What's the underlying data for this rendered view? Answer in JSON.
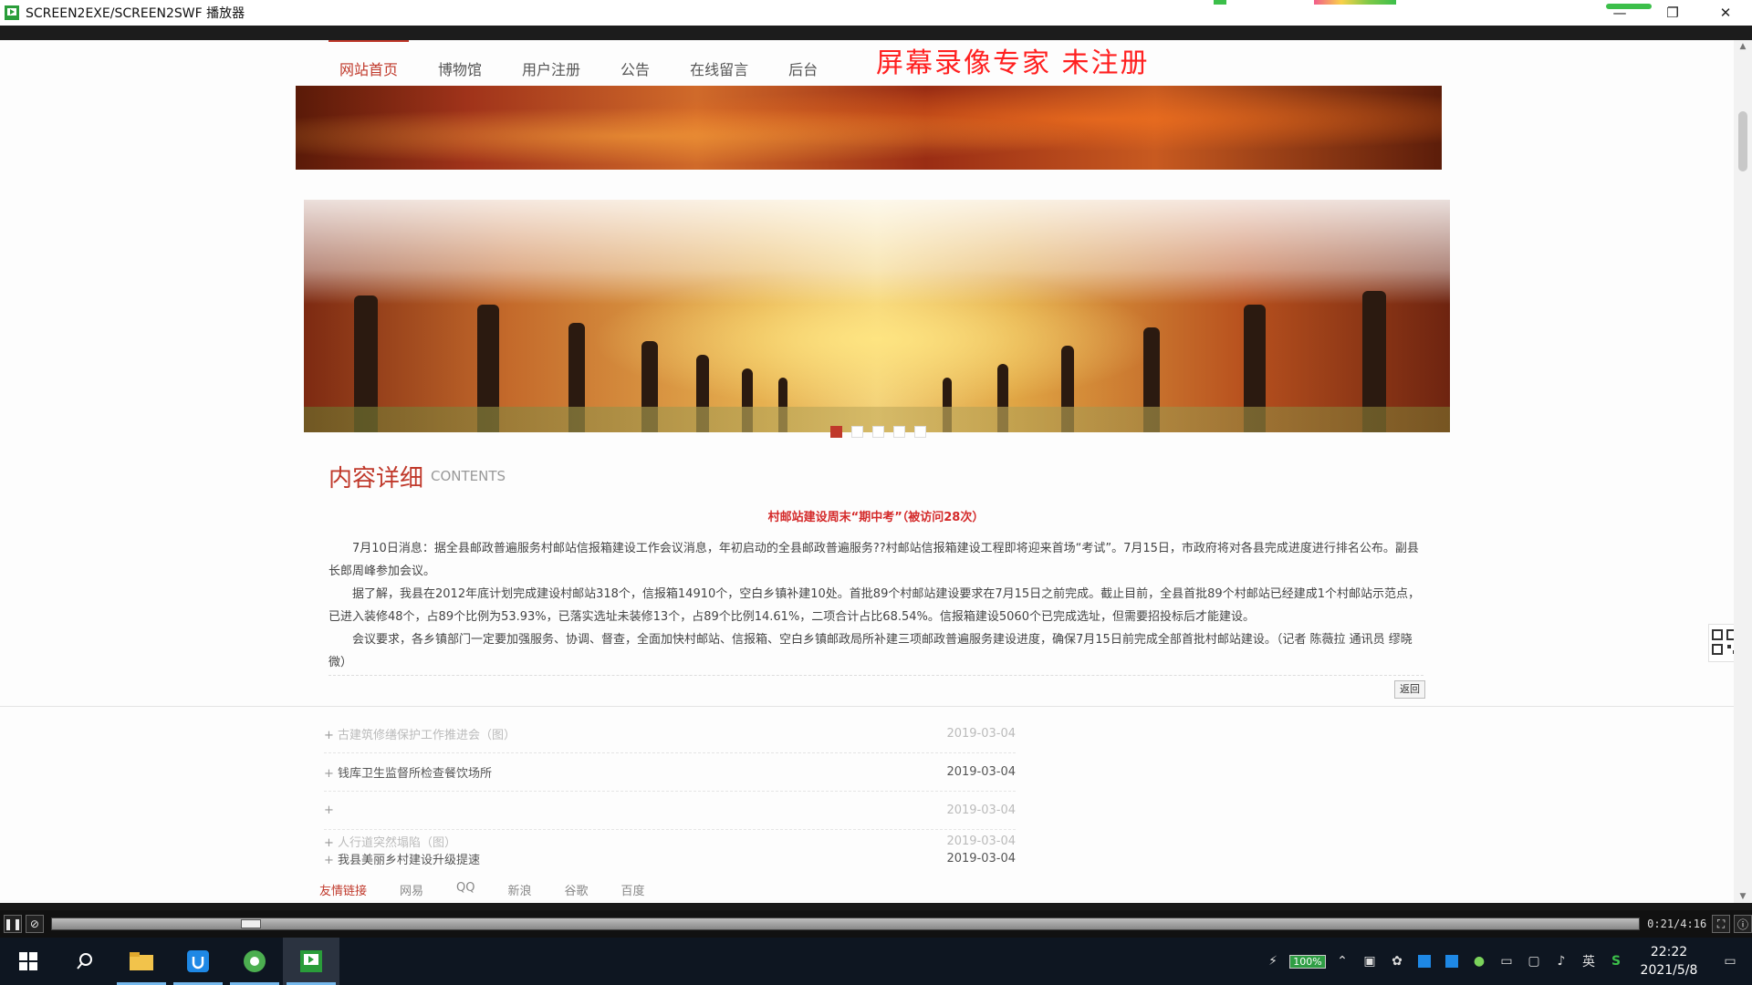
{
  "window": {
    "title": "SCREEN2EXE/SCREEN2SWF 播放器",
    "min": "—",
    "max": "❐",
    "close": "✕"
  },
  "watermark": "屏幕录像专家  未注册",
  "nav": {
    "items": [
      "网站首页",
      "博物馆",
      "用户注册",
      "公告",
      "在线留言",
      "后台"
    ]
  },
  "section": {
    "title": "内容详细",
    "subtitle": "CONTENTS"
  },
  "article": {
    "title": "村邮站建设周末“期中考”（被访问28次）",
    "paragraphs": [
      "7月10日消息：据全县邮政普遍服务村邮站信报箱建设工作会议消息，年初启动的全县邮政普遍服务??村邮站信报箱建设工程即将迎来首场“考试”。7月15日，市政府将对各县完成进度进行排名公布。副县长郎周峰参加会议。",
      "据了解，我县在2012年底计划完成建设村邮站318个，信报箱14910个，空白乡镇补建10处。首批89个村邮站建设要求在7月15日之前完成。截止目前，全县首批89个村邮站已经建成1个村邮站示范点，已进入装修48个，占89个比例为53.93%，已落实选址未装修13个，占89个比例14.61%，二项合计占比68.54%。信报箱建设5060个已完成选址，但需要招投标后才能建设。",
      "会议要求，各乡镇部门一定要加强服务、协调、督查，全面加快村邮站、信报箱、空白乡镇邮政局所补建三项邮政普遍服务建设进度，确保7月15日前完成全部首批村邮站建设。（记者 陈薇拉 通讯员 缪晓微）"
    ],
    "back": "返回"
  },
  "news": [
    {
      "label": "古建筑修缮保护工作推进会（图）",
      "date": "2019-03-04",
      "faded": true
    },
    {
      "label": "钱库卫生监督所检查餐饮场所",
      "date": "2019-03-04",
      "faded": false
    },
    {
      "label": "",
      "date": "2019-03-04",
      "faded": true
    },
    {
      "label": "人行道突然塌陷（图）",
      "date": "2019-03-04",
      "faded": true
    },
    {
      "label": "我县美丽乡村建设升级提速",
      "date": "2019-03-04",
      "faded": false
    }
  ],
  "friends": {
    "lead": "友情链接",
    "links": [
      "网易",
      "QQ",
      "新浪",
      "谷歌",
      "百度"
    ]
  },
  "player": {
    "pause": "❚❚",
    "stop": "⊘",
    "time": "0:21/4:16",
    "progress": 0.08
  },
  "taskbar": {
    "battery": "100%",
    "ime": "英",
    "time": "22:22",
    "date": "2021/5/8"
  },
  "colors": {
    "accent": "#c0392b",
    "watermark": "#ff2020",
    "taskbar": "#0e1621"
  }
}
